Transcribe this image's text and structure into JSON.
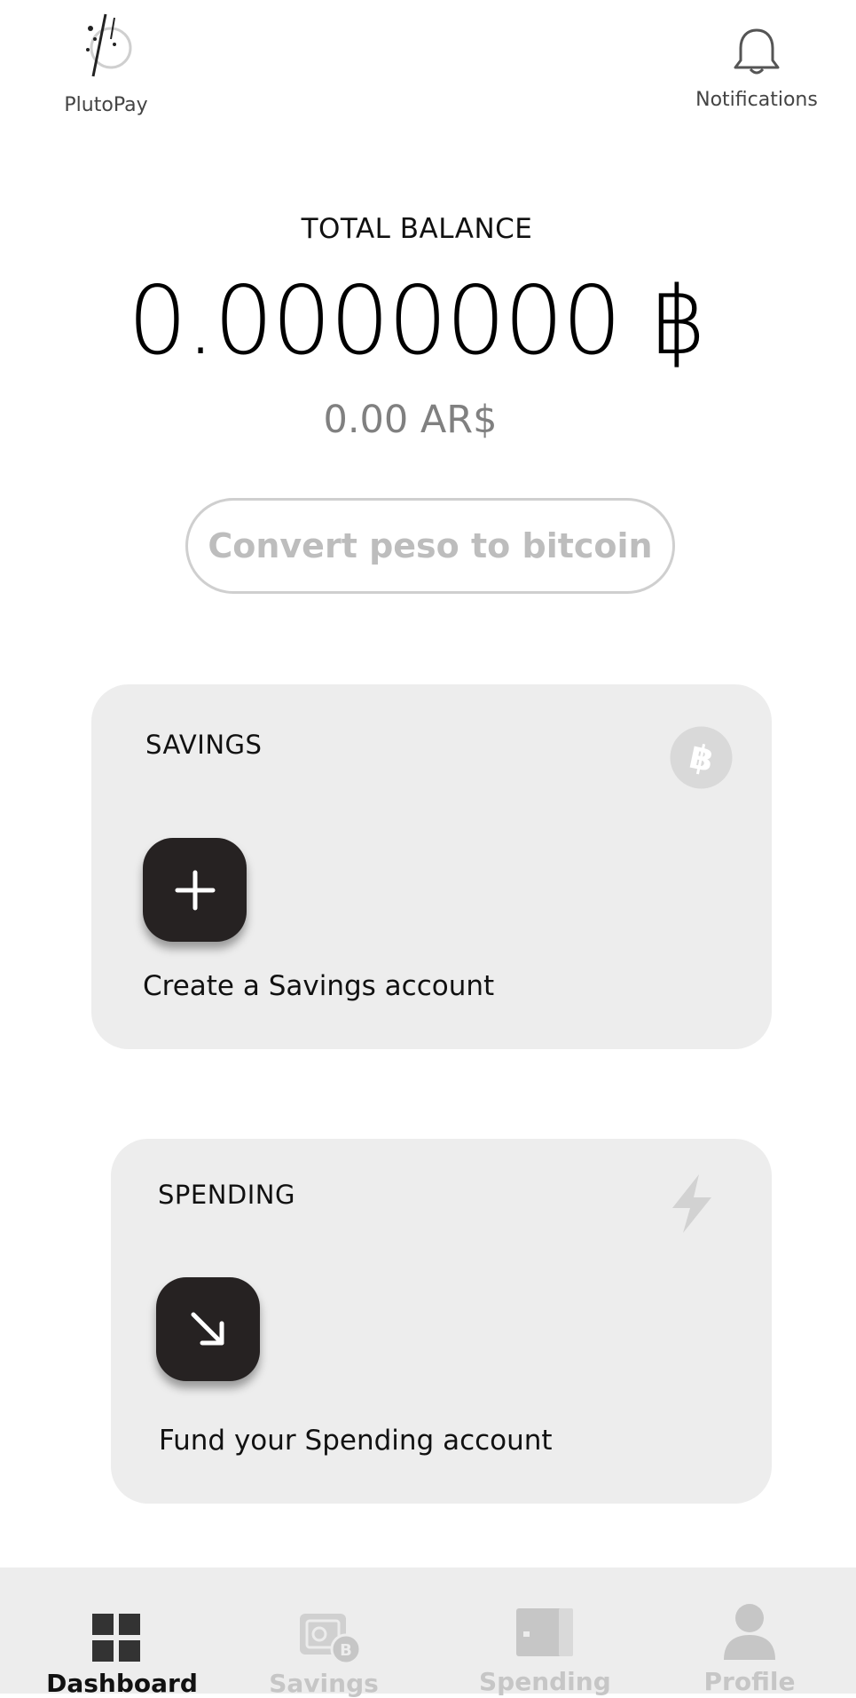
{
  "header": {
    "app_name": "PlutoPay",
    "notifications_label": "Notifications"
  },
  "balance": {
    "title": "TOTAL BALANCE",
    "btc_amount": "0.0000000 ฿",
    "fiat_amount": "0.00 AR$"
  },
  "convert_button_label": "Convert peso to bitcoin",
  "savings": {
    "title": "SAVINGS",
    "action_text": "Create a Savings account",
    "icon": "bitcoin-icon",
    "action_icon": "plus-icon"
  },
  "spending": {
    "title": "SPENDING",
    "action_text": "Fund your Spending account",
    "icon": "lightning-icon",
    "action_icon": "arrow-down-right-icon"
  },
  "nav": {
    "items": [
      {
        "label": "Dashboard",
        "icon": "grid-icon",
        "active": true
      },
      {
        "label": "Savings",
        "icon": "safe-bitcoin-icon",
        "active": false
      },
      {
        "label": "Spending",
        "icon": "wallet-icon",
        "active": false
      },
      {
        "label": "Profile",
        "icon": "person-icon",
        "active": false
      }
    ]
  },
  "colors": {
    "card_bg": "#ededed",
    "action_button": "#262222",
    "muted_text": "#808080",
    "inactive_nav": "#bdbdbd"
  }
}
